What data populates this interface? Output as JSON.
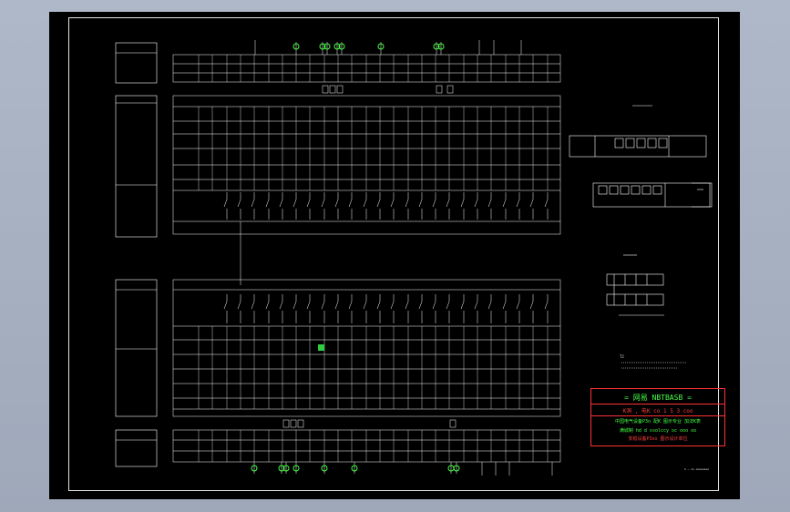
{
  "drawing": {
    "title_line": "= 网易 NBTBASB =",
    "line2": "K洞 , 电K    co 1 5 3 coo",
    "line3": "中国电气设备P3o 配K 图示专业  加法K表",
    "line4": "满城制  hd d ssolccy oc ooo oo",
    "line5": "安稳设备P3oo 图示设计单位",
    "note_t2": "T2",
    "scale_text": "1 — co oooooooo"
  },
  "colors": {
    "background": "#a7b1c2",
    "sheet": "#000000",
    "lines": "#ffffff",
    "accent_green": "#44ff44",
    "accent_red": "#ff3b3b"
  }
}
